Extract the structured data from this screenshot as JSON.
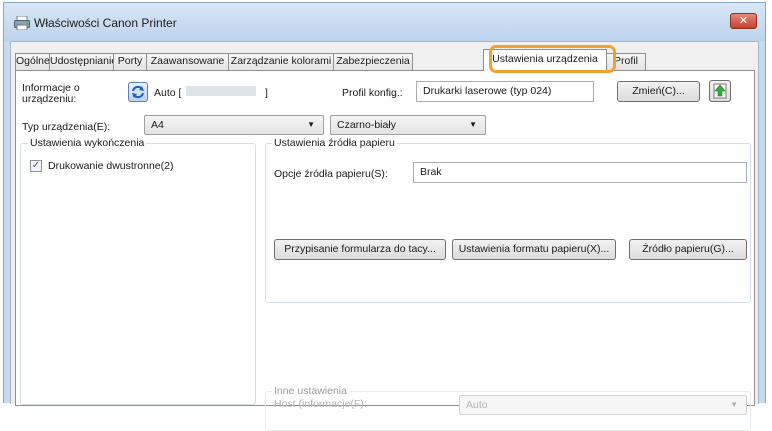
{
  "window": {
    "title": "Właściwości Canon Printer",
    "close_label": "✕"
  },
  "tabs": [
    "Ogólne",
    "Udostępnianie",
    "Porty",
    "Zaawansowane",
    "Zarządzanie kolorami",
    "Zabezpieczenia",
    "Ustawienia urządzenia",
    "Profil"
  ],
  "info": {
    "label_line1": "Informacje o",
    "label_line2": "urządzeniu:",
    "auto_prefix": "Auto [",
    "auto_suffix": "]",
    "profile_label": "Profil konfig.:",
    "profile_value": "Drukarki laserowe (typ 024)",
    "change_button": "Zmień(C)..."
  },
  "device_type": {
    "label": "Typ urządzenia(E):",
    "model_value": "A4",
    "color_value": "Czarno-biały"
  },
  "finishing": {
    "title": "Ustawienia wykończenia",
    "duplex_label": "Drukowanie dwustronne(2)",
    "duplex_checked": true
  },
  "paper_source": {
    "title": "Ustawienia źródła papieru",
    "option_label": "Opcje źródła papieru(S):",
    "option_value": "Brak",
    "btn_assign": "Przypisanie formularza do tacy...",
    "btn_format": "Ustawienia formatu papieru(X)...",
    "btn_source": "Źródło papieru(G)..."
  },
  "other": {
    "title": "Inne ustawienia",
    "host_label": "Host (informacje(F):",
    "host_value": "Auto"
  }
}
